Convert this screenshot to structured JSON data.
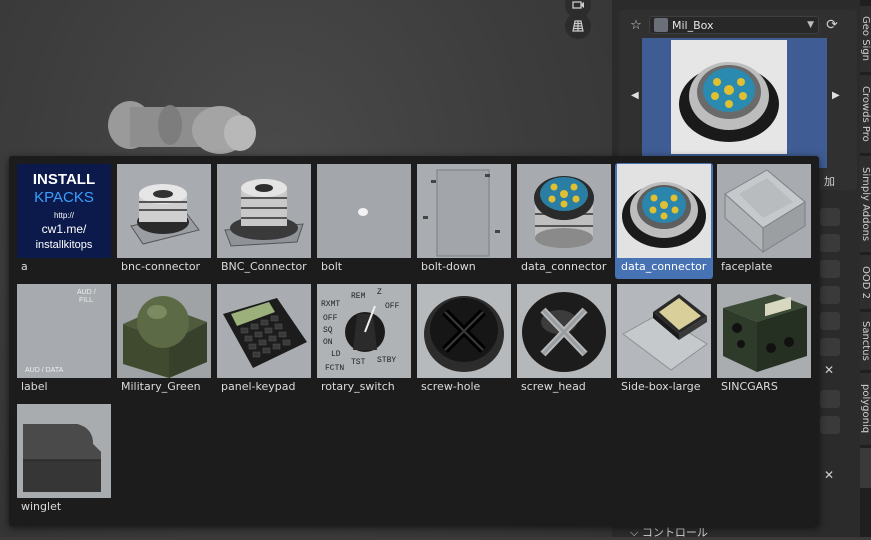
{
  "asset_selector": {
    "current": "Mil_Box"
  },
  "side_tabs": [
    "Geo Sign",
    "Crowds Pro",
    "Simply Addons",
    "OOD 2",
    "Sanctus",
    "polygoniq"
  ],
  "add_label": "加",
  "controls_label": "コントロール",
  "install_thumb": {
    "line1": "INSTALL",
    "line2": "KPACKS",
    "line3": "http://",
    "line4": "cw1.me/",
    "line5": "installkitops"
  },
  "label_thumb": {
    "top1": "AUD /",
    "top2": "FILL",
    "bottom": "AUD / DATA"
  },
  "rotary_thumb": {
    "l1": "RXMT",
    "l2": "OFF",
    "l3": "SQ",
    "l4": "ON",
    "l5": "LD",
    "l6": "FCTN",
    "r1": "REM",
    "r2": "Z",
    "r3": "OFF",
    "r4": "TST",
    "r5": "STBY"
  },
  "assets": [
    {
      "name": "a",
      "selected": false
    },
    {
      "name": "bnc-connector",
      "selected": false
    },
    {
      "name": "BNC_Connector",
      "selected": false
    },
    {
      "name": "bolt",
      "selected": false
    },
    {
      "name": "bolt-down",
      "selected": false
    },
    {
      "name": "data_connector",
      "selected": false
    },
    {
      "name": "data_connector",
      "selected": true
    },
    {
      "name": "faceplate",
      "selected": false
    },
    {
      "name": "label",
      "selected": false
    },
    {
      "name": "Military_Green",
      "selected": false
    },
    {
      "name": "panel-keypad",
      "selected": false
    },
    {
      "name": "rotary_switch",
      "selected": false
    },
    {
      "name": "screw-hole",
      "selected": false
    },
    {
      "name": "screw_head",
      "selected": false
    },
    {
      "name": "Side-box-large",
      "selected": false
    },
    {
      "name": "SINCGARS",
      "selected": false
    },
    {
      "name": "winglet",
      "selected": false
    }
  ],
  "colors": {
    "selection": "#4772b3",
    "popup_bg": "#1c1c1c",
    "viewport_bg": "#3c3c3c"
  }
}
